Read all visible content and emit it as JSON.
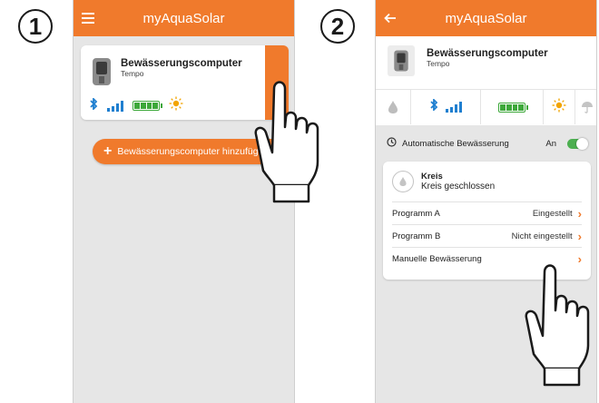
{
  "steps": [
    "1",
    "2"
  ],
  "screen1": {
    "app_title": "myAquaSolar",
    "menu_icon": "hamburger-icon",
    "device": {
      "title": "Bewässerungscomputer",
      "subtitle": "Tempo",
      "icons": [
        "bluetooth-icon",
        "signal-icon",
        "battery-icon",
        "sun-icon"
      ]
    },
    "add_button_label": "Bewässerungscomputer hinzufügen",
    "add_button_icon": "+"
  },
  "screen2": {
    "app_title": "myAquaSolar",
    "back_icon": "back-arrow-icon",
    "device": {
      "title": "Bewässerungscomputer",
      "subtitle": "Tempo"
    },
    "status_icons": [
      "water-drop-icon",
      "bluetooth-icon",
      "signal-icon",
      "battery-icon",
      "sun-icon",
      "umbrella-icon"
    ],
    "auto_irrigation": {
      "label": "Automatische Bewässerung",
      "state": "An",
      "enabled": true
    },
    "circuit": {
      "title": "Kreis",
      "status": "Kreis geschlossen"
    },
    "rows": [
      {
        "label": "Programm A",
        "value": "Eingestellt"
      },
      {
        "label": "Programm B",
        "value": "Nicht eingestellt"
      },
      {
        "label": "Manuelle Bewässerung",
        "value": ""
      }
    ]
  },
  "colors": {
    "accent": "#f07a2c",
    "bluetooth": "#1f7fd0",
    "battery": "#3da83a",
    "sun": "#f2a400",
    "toggle": "#4caf50"
  }
}
